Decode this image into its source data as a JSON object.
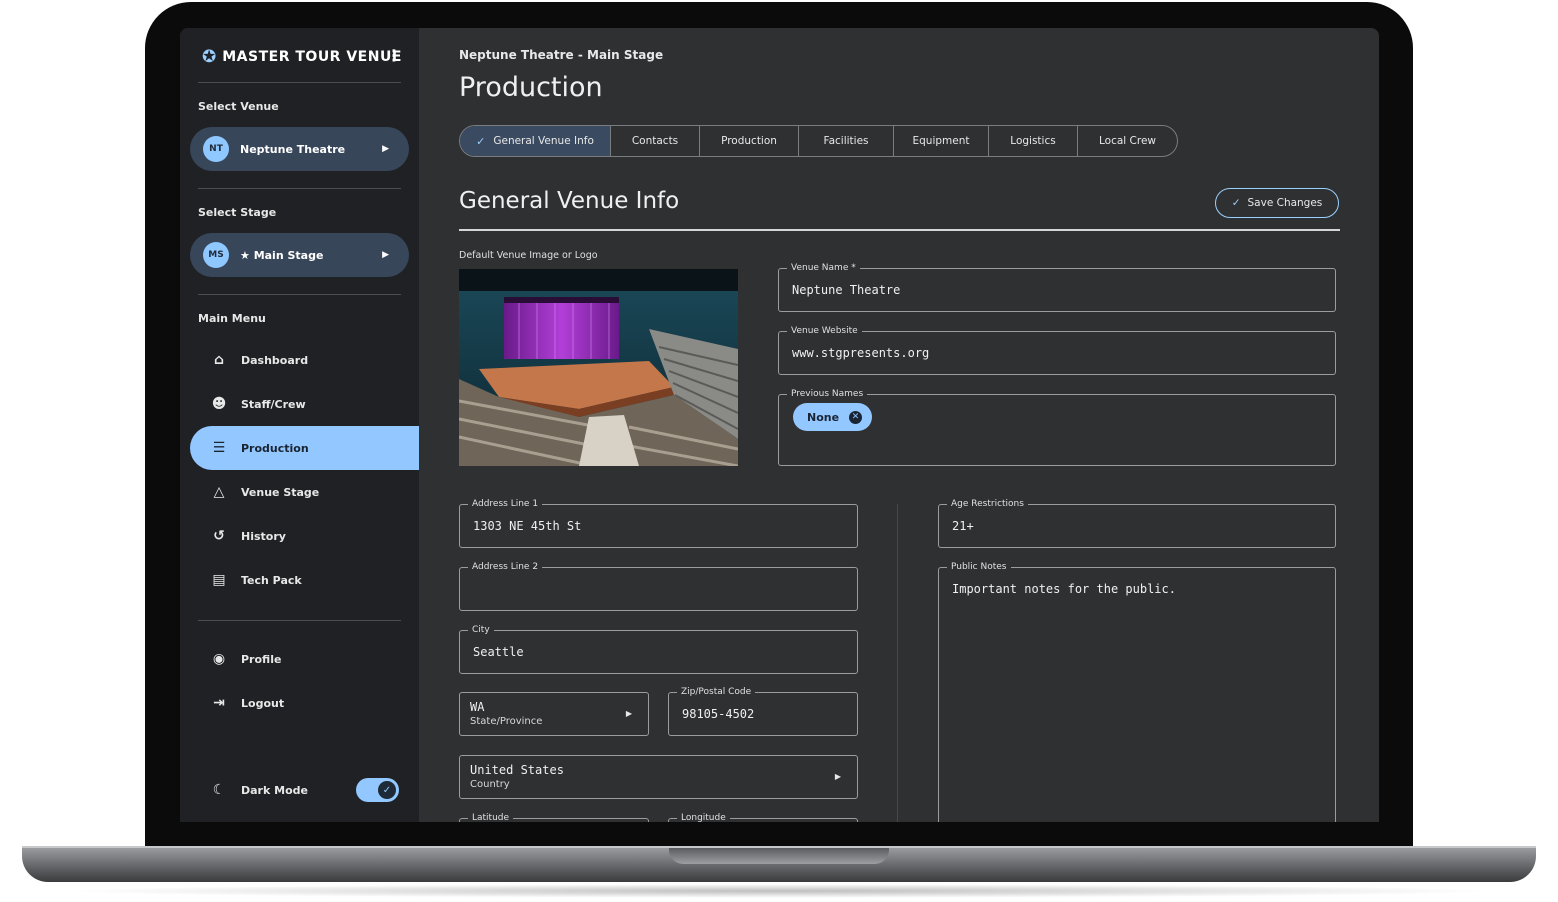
{
  "app": {
    "brand": "MASTER TOUR VENUE"
  },
  "sidebar": {
    "select_venue_label": "Select Venue",
    "venue": {
      "initials": "NT",
      "name": "Neptune Theatre"
    },
    "select_stage_label": "Select Stage",
    "stage": {
      "initials": "MS",
      "name": "★ Main Stage"
    },
    "main_menu_label": "Main Menu",
    "menu_items": [
      {
        "label": "Dashboard",
        "icon": "home-icon",
        "active": false
      },
      {
        "label": "Staff/Crew",
        "icon": "people-icon",
        "active": false
      },
      {
        "label": "Production",
        "icon": "sliders-icon",
        "active": true
      },
      {
        "label": "Venue Stage",
        "icon": "shapes-icon",
        "active": false
      },
      {
        "label": "History",
        "icon": "history-icon",
        "active": false
      },
      {
        "label": "Tech Pack",
        "icon": "document-icon",
        "active": false
      }
    ],
    "profile_label": "Profile",
    "logout_label": "Logout",
    "dark_mode_label": "Dark Mode",
    "dark_mode_on": true
  },
  "header": {
    "breadcrumb": "Neptune Theatre - Main Stage",
    "title": "Production"
  },
  "tabs": [
    {
      "label": "General Venue Info",
      "active": true
    },
    {
      "label": "Contacts",
      "active": false
    },
    {
      "label": "Production",
      "active": false
    },
    {
      "label": "Facilities",
      "active": false
    },
    {
      "label": "Equipment",
      "active": false
    },
    {
      "label": "Logistics",
      "active": false
    },
    {
      "label": "Local Crew",
      "active": false
    }
  ],
  "section": {
    "title": "General Venue Info",
    "save_label": "Save Changes",
    "image_label": "Default Venue Image or Logo"
  },
  "form": {
    "venue_name_label": "Venue Name *",
    "venue_name": "Neptune Theatre",
    "venue_website_label": "Venue Website",
    "venue_website": "www.stgpresents.org",
    "previous_names_label": "Previous Names",
    "previous_names_chip": "None",
    "address1_label": "Address Line 1",
    "address1": "1303 NE 45th St",
    "address2_label": "Address Line 2",
    "address2": "",
    "city_label": "City",
    "city": "Seattle",
    "state_value": "WA",
    "state_label": "State/Province",
    "zip_label": "Zip/Postal Code",
    "zip": "98105-4502",
    "country_value": "United States",
    "country_label": "Country",
    "latitude_label": "Latitude",
    "longitude_label": "Longitude",
    "age_label": "Age Restrictions",
    "age": "21+",
    "notes_label": "Public Notes",
    "notes": "Important notes for the public."
  },
  "colors": {
    "accent": "#93c7ff",
    "sidebar_bg": "#1f2124",
    "content_bg": "#2f3032"
  }
}
